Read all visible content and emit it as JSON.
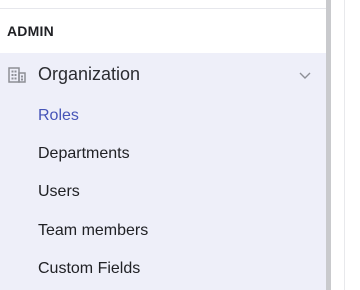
{
  "sidebar": {
    "section_heading": "ADMIN",
    "group": {
      "title": "Organization",
      "icon": "building-icon",
      "expanded": true,
      "items": [
        {
          "label": "Roles",
          "active": true
        },
        {
          "label": "Departments",
          "active": false
        },
        {
          "label": "Users",
          "active": false
        },
        {
          "label": "Team members",
          "active": false
        },
        {
          "label": "Custom Fields",
          "active": false
        }
      ]
    }
  },
  "colors": {
    "active_text": "#4654b8",
    "group_background": "#eeeff9",
    "scrollbar": "#c9cacd"
  }
}
